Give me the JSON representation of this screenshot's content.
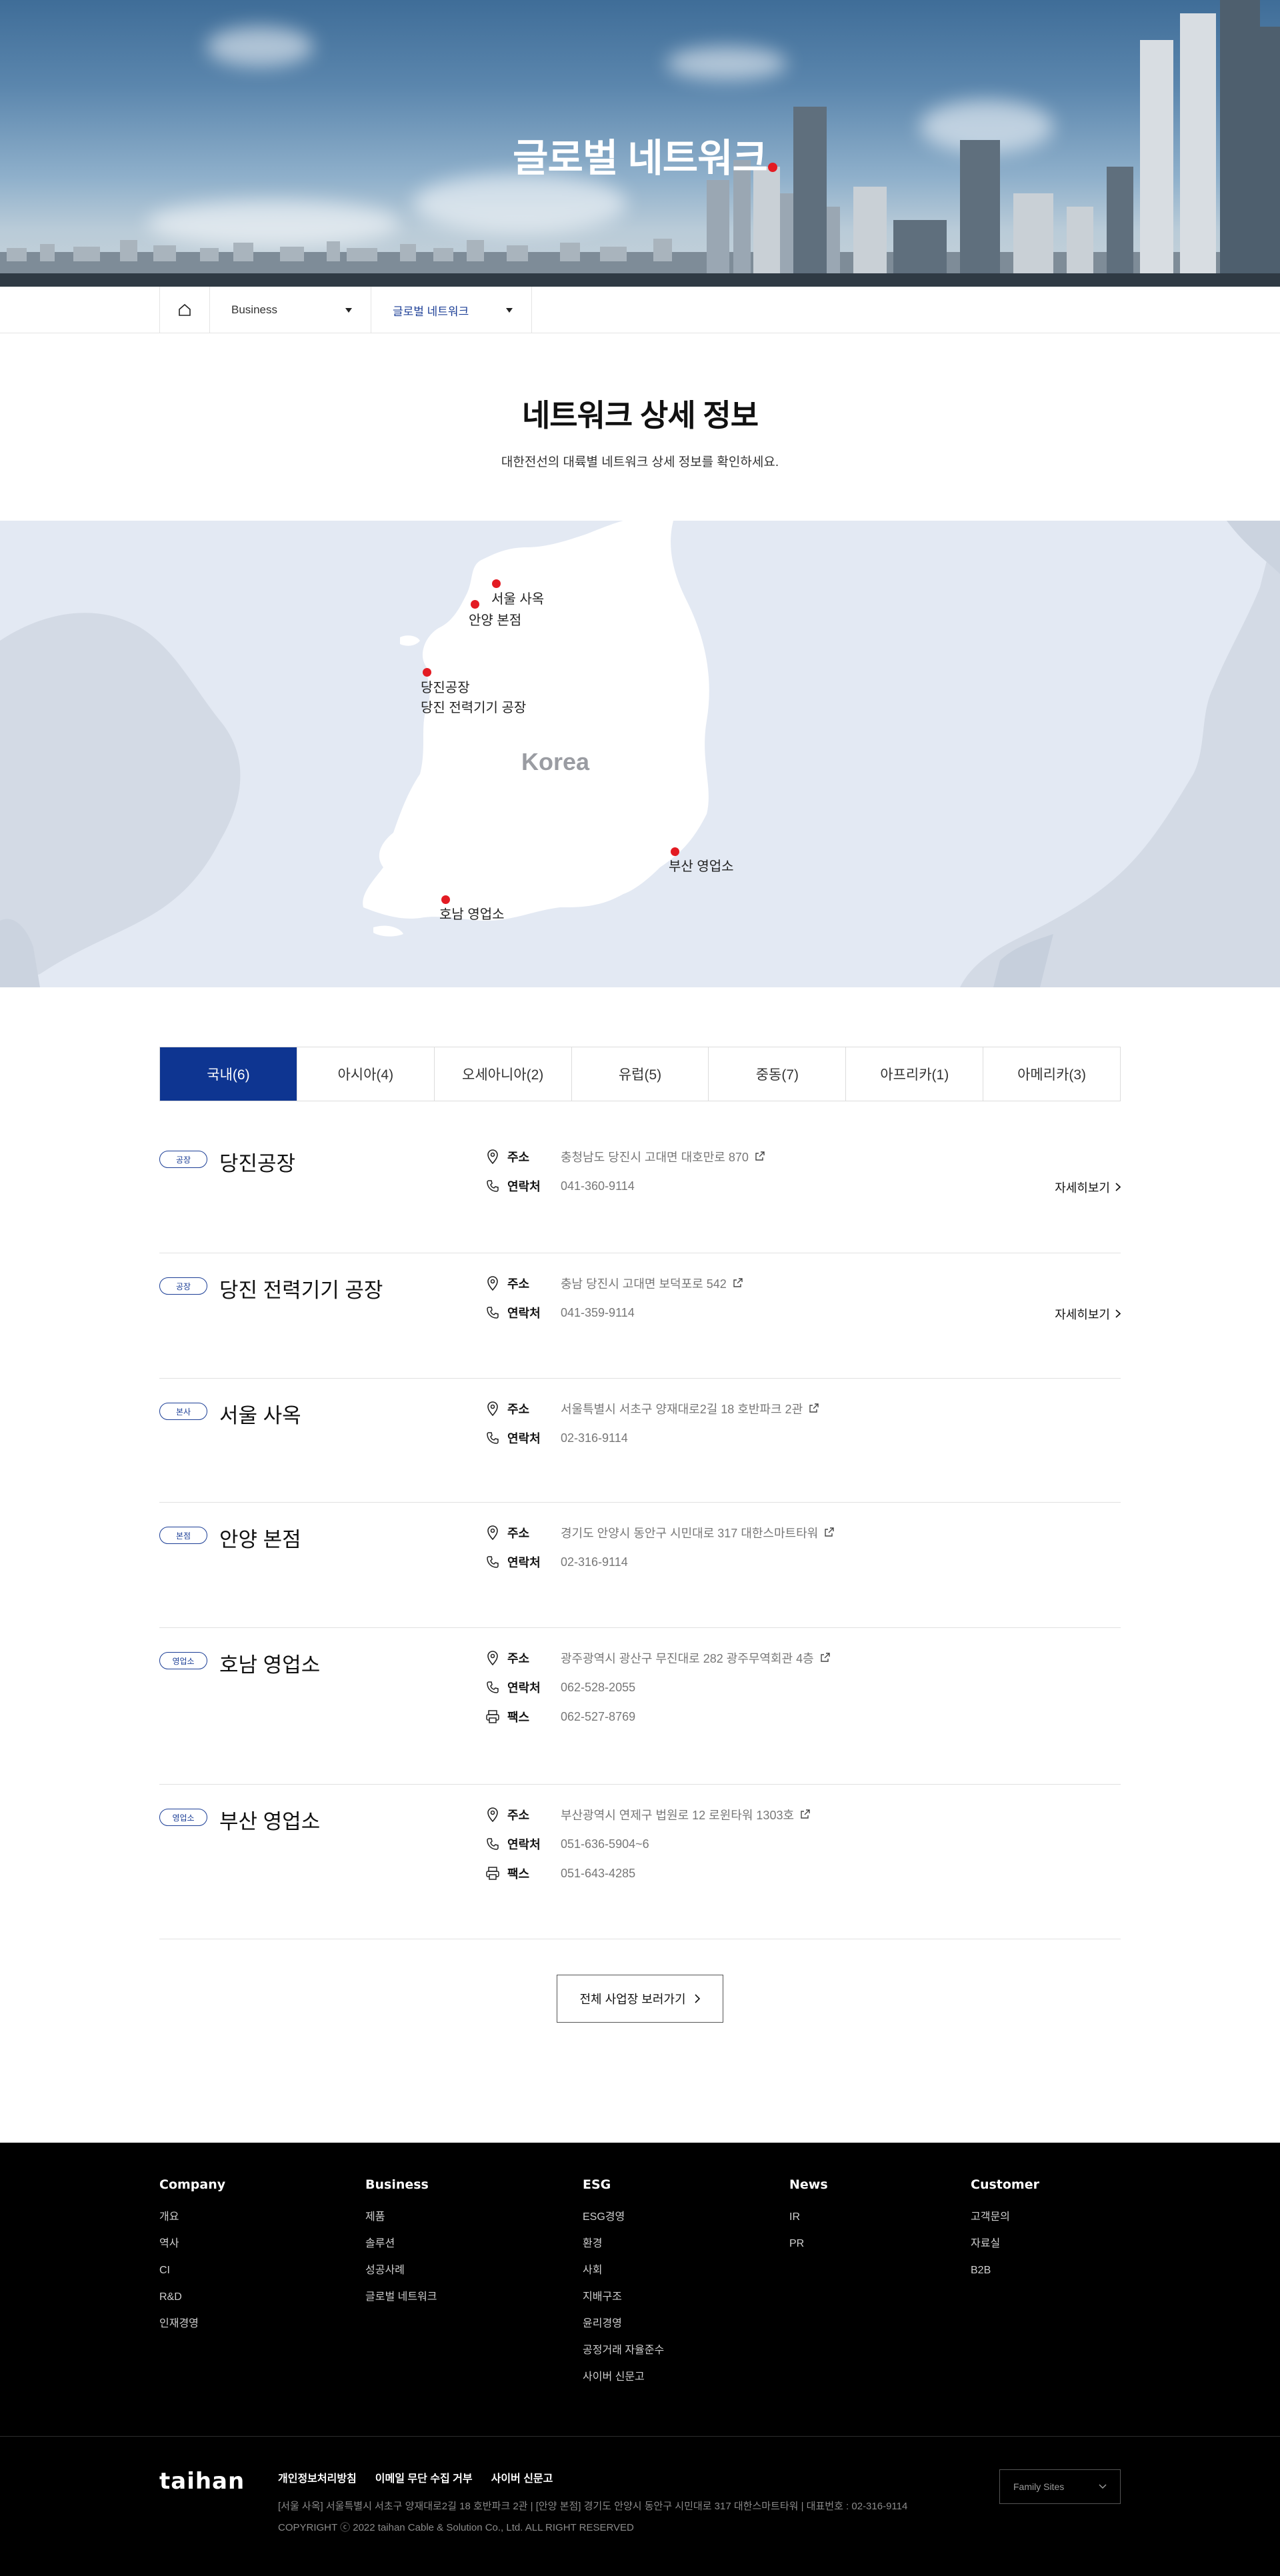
{
  "hero": {
    "title": "글로벌 네트워크"
  },
  "breadcrumb": {
    "level1": "Business",
    "level2": "글로벌 네트워크"
  },
  "intro": {
    "title": "네트워크 상세 정보",
    "subtitle": "대한전선의 대륙별 네트워크 상세 정보를 확인하세요."
  },
  "map": {
    "country": "Korea",
    "labels": {
      "seoul": "서울 사옥",
      "anyang": "안양 본점",
      "dangjin": "당진공장",
      "dangjin_power": "당진 전력기기 공장",
      "busan": "부산 영업소",
      "honam": "호남 영업소"
    },
    "pin_color": "#e31b23"
  },
  "tabs": [
    {
      "label": "국내(6)",
      "active": true
    },
    {
      "label": "아시아(4)",
      "active": false
    },
    {
      "label": "오세아니아(2)",
      "active": false
    },
    {
      "label": "유럽(5)",
      "active": false
    },
    {
      "label": "중동(7)",
      "active": false
    },
    {
      "label": "아프리카(1)",
      "active": false
    },
    {
      "label": "아메리카(3)",
      "active": false
    }
  ],
  "labels": {
    "address": "주소",
    "contact": "연락처",
    "fax": "팩스",
    "more": "자세히보기"
  },
  "locations": [
    {
      "badge": "공장",
      "name": "당진공장",
      "address": "충청남도 당진시 고대면 대호만로 870",
      "contact": "041-360-9114",
      "fax": "",
      "more": true
    },
    {
      "badge": "공장",
      "name": "당진 전력기기 공장",
      "address": "충남 당진시 고대면 보덕포로 542",
      "contact": "041-359-9114",
      "fax": "",
      "more": true
    },
    {
      "badge": "본사",
      "name": "서울 사옥",
      "address": "서울특별시 서초구 양재대로2길 18 호반파크 2관",
      "contact": "02-316-9114",
      "fax": "",
      "more": false
    },
    {
      "badge": "본점",
      "name": "안양 본점",
      "address": "경기도 안양시 동안구 시민대로 317 대한스마트타워",
      "contact": "02-316-9114",
      "fax": "",
      "more": false
    },
    {
      "badge": "영업소",
      "name": "호남 영업소",
      "address": "광주광역시 광산구 무진대로 282 광주무역회관 4층",
      "contact": "062-528-2055",
      "fax": "062-527-8769",
      "more": false
    },
    {
      "badge": "영업소",
      "name": "부산 영업소",
      "address": "부산광역시 연제구 법원로 12 로윈타워 1303호",
      "contact": "051-636-5904~6",
      "fax": "051-643-4285",
      "more": false
    }
  ],
  "all_button": "전체 사업장 보러가기",
  "footer": {
    "columns": [
      {
        "title": "Company",
        "links": [
          "개요",
          "역사",
          "CI",
          "R&D",
          "인재경영"
        ]
      },
      {
        "title": "Business",
        "links": [
          "제품",
          "솔루션",
          "성공사례",
          "글로벌 네트워크"
        ]
      },
      {
        "title": "ESG",
        "links": [
          "ESG경영",
          "환경",
          "사회",
          "지배구조",
          "윤리경영",
          "공정거래 자율준수",
          "사이버 신문고"
        ]
      },
      {
        "title": "News",
        "links": [
          "IR",
          "PR"
        ]
      },
      {
        "title": "Customer",
        "links": [
          "고객문의",
          "자료실",
          "B2B"
        ]
      }
    ],
    "logo": "taihan",
    "legal_links": [
      "개인정보처리방침",
      "이메일 무단 수집 거부",
      "사이버 신문고"
    ],
    "address": "[서울 사옥] 서울특별시 서초구 양재대로2길 18 호반파크 2관   |   [안양 본점] 경기도 안양시 동안구 시민대로 317 대한스마트타워   |   대표번호 : 02-316-9114",
    "copyright": "COPYRIGHT ⓒ 2022 taihan Cable & Solution Co., Ltd. ALL RIGHT RESERVED",
    "family_sites": "Family Sites"
  }
}
